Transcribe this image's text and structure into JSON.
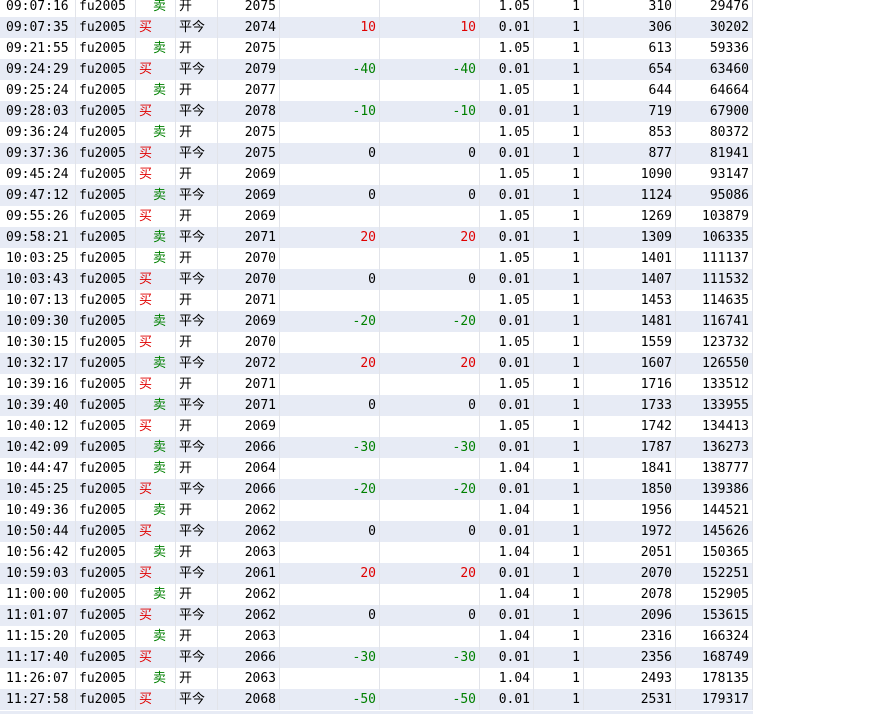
{
  "table": {
    "rows": [
      {
        "time": "09:07:16",
        "code": "fu2005",
        "dir": "卖",
        "side": "sell",
        "oc": "开",
        "price": "2075",
        "pl1": "",
        "pl2": "",
        "fee": "1.05",
        "qty": "1",
        "v1": "310",
        "v2": "29476"
      },
      {
        "time": "09:07:35",
        "code": "fu2005",
        "dir": "买",
        "side": "buy",
        "oc": "平今",
        "price": "2074",
        "pl1": "10",
        "pl2": "10",
        "fee": "0.01",
        "qty": "1",
        "v1": "306",
        "v2": "30202"
      },
      {
        "time": "09:21:55",
        "code": "fu2005",
        "dir": "卖",
        "side": "sell",
        "oc": "开",
        "price": "2075",
        "pl1": "",
        "pl2": "",
        "fee": "1.05",
        "qty": "1",
        "v1": "613",
        "v2": "59336"
      },
      {
        "time": "09:24:29",
        "code": "fu2005",
        "dir": "买",
        "side": "buy",
        "oc": "平今",
        "price": "2079",
        "pl1": "-40",
        "pl2": "-40",
        "fee": "0.01",
        "qty": "1",
        "v1": "654",
        "v2": "63460"
      },
      {
        "time": "09:25:24",
        "code": "fu2005",
        "dir": "卖",
        "side": "sell",
        "oc": "开",
        "price": "2077",
        "pl1": "",
        "pl2": "",
        "fee": "1.05",
        "qty": "1",
        "v1": "644",
        "v2": "64664"
      },
      {
        "time": "09:28:03",
        "code": "fu2005",
        "dir": "买",
        "side": "buy",
        "oc": "平今",
        "price": "2078",
        "pl1": "-10",
        "pl2": "-10",
        "fee": "0.01",
        "qty": "1",
        "v1": "719",
        "v2": "67900"
      },
      {
        "time": "09:36:24",
        "code": "fu2005",
        "dir": "卖",
        "side": "sell",
        "oc": "开",
        "price": "2075",
        "pl1": "",
        "pl2": "",
        "fee": "1.05",
        "qty": "1",
        "v1": "853",
        "v2": "80372"
      },
      {
        "time": "09:37:36",
        "code": "fu2005",
        "dir": "买",
        "side": "buy",
        "oc": "平今",
        "price": "2075",
        "pl1": "0",
        "pl2": "0",
        "fee": "0.01",
        "qty": "1",
        "v1": "877",
        "v2": "81941"
      },
      {
        "time": "09:45:24",
        "code": "fu2005",
        "dir": "买",
        "side": "buy",
        "oc": "开",
        "price": "2069",
        "pl1": "",
        "pl2": "",
        "fee": "1.05",
        "qty": "1",
        "v1": "1090",
        "v2": "93147"
      },
      {
        "time": "09:47:12",
        "code": "fu2005",
        "dir": "卖",
        "side": "sell",
        "oc": "平今",
        "price": "2069",
        "pl1": "0",
        "pl2": "0",
        "fee": "0.01",
        "qty": "1",
        "v1": "1124",
        "v2": "95086"
      },
      {
        "time": "09:55:26",
        "code": "fu2005",
        "dir": "买",
        "side": "buy",
        "oc": "开",
        "price": "2069",
        "pl1": "",
        "pl2": "",
        "fee": "1.05",
        "qty": "1",
        "v1": "1269",
        "v2": "103879"
      },
      {
        "time": "09:58:21",
        "code": "fu2005",
        "dir": "卖",
        "side": "sell",
        "oc": "平今",
        "price": "2071",
        "pl1": "20",
        "pl2": "20",
        "fee": "0.01",
        "qty": "1",
        "v1": "1309",
        "v2": "106335"
      },
      {
        "time": "10:03:25",
        "code": "fu2005",
        "dir": "卖",
        "side": "sell",
        "oc": "开",
        "price": "2070",
        "pl1": "",
        "pl2": "",
        "fee": "1.05",
        "qty": "1",
        "v1": "1401",
        "v2": "111137"
      },
      {
        "time": "10:03:43",
        "code": "fu2005",
        "dir": "买",
        "side": "buy",
        "oc": "平今",
        "price": "2070",
        "pl1": "0",
        "pl2": "0",
        "fee": "0.01",
        "qty": "1",
        "v1": "1407",
        "v2": "111532"
      },
      {
        "time": "10:07:13",
        "code": "fu2005",
        "dir": "买",
        "side": "buy",
        "oc": "开",
        "price": "2071",
        "pl1": "",
        "pl2": "",
        "fee": "1.05",
        "qty": "1",
        "v1": "1453",
        "v2": "114635"
      },
      {
        "time": "10:09:30",
        "code": "fu2005",
        "dir": "卖",
        "side": "sell",
        "oc": "平今",
        "price": "2069",
        "pl1": "-20",
        "pl2": "-20",
        "fee": "0.01",
        "qty": "1",
        "v1": "1481",
        "v2": "116741"
      },
      {
        "time": "10:30:15",
        "code": "fu2005",
        "dir": "买",
        "side": "buy",
        "oc": "开",
        "price": "2070",
        "pl1": "",
        "pl2": "",
        "fee": "1.05",
        "qty": "1",
        "v1": "1559",
        "v2": "123732"
      },
      {
        "time": "10:32:17",
        "code": "fu2005",
        "dir": "卖",
        "side": "sell",
        "oc": "平今",
        "price": "2072",
        "pl1": "20",
        "pl2": "20",
        "fee": "0.01",
        "qty": "1",
        "v1": "1607",
        "v2": "126550"
      },
      {
        "time": "10:39:16",
        "code": "fu2005",
        "dir": "买",
        "side": "buy",
        "oc": "开",
        "price": "2071",
        "pl1": "",
        "pl2": "",
        "fee": "1.05",
        "qty": "1",
        "v1": "1716",
        "v2": "133512"
      },
      {
        "time": "10:39:40",
        "code": "fu2005",
        "dir": "卖",
        "side": "sell",
        "oc": "平今",
        "price": "2071",
        "pl1": "0",
        "pl2": "0",
        "fee": "0.01",
        "qty": "1",
        "v1": "1733",
        "v2": "133955"
      },
      {
        "time": "10:40:12",
        "code": "fu2005",
        "dir": "买",
        "side": "buy",
        "oc": "开",
        "price": "2069",
        "pl1": "",
        "pl2": "",
        "fee": "1.05",
        "qty": "1",
        "v1": "1742",
        "v2": "134413"
      },
      {
        "time": "10:42:09",
        "code": "fu2005",
        "dir": "卖",
        "side": "sell",
        "oc": "平今",
        "price": "2066",
        "pl1": "-30",
        "pl2": "-30",
        "fee": "0.01",
        "qty": "1",
        "v1": "1787",
        "v2": "136273"
      },
      {
        "time": "10:44:47",
        "code": "fu2005",
        "dir": "卖",
        "side": "sell",
        "oc": "开",
        "price": "2064",
        "pl1": "",
        "pl2": "",
        "fee": "1.04",
        "qty": "1",
        "v1": "1841",
        "v2": "138777"
      },
      {
        "time": "10:45:25",
        "code": "fu2005",
        "dir": "买",
        "side": "buy",
        "oc": "平今",
        "price": "2066",
        "pl1": "-20",
        "pl2": "-20",
        "fee": "0.01",
        "qty": "1",
        "v1": "1850",
        "v2": "139386"
      },
      {
        "time": "10:49:36",
        "code": "fu2005",
        "dir": "卖",
        "side": "sell",
        "oc": "开",
        "price": "2062",
        "pl1": "",
        "pl2": "",
        "fee": "1.04",
        "qty": "1",
        "v1": "1956",
        "v2": "144521"
      },
      {
        "time": "10:50:44",
        "code": "fu2005",
        "dir": "买",
        "side": "buy",
        "oc": "平今",
        "price": "2062",
        "pl1": "0",
        "pl2": "0",
        "fee": "0.01",
        "qty": "1",
        "v1": "1972",
        "v2": "145626"
      },
      {
        "time": "10:56:42",
        "code": "fu2005",
        "dir": "卖",
        "side": "sell",
        "oc": "开",
        "price": "2063",
        "pl1": "",
        "pl2": "",
        "fee": "1.04",
        "qty": "1",
        "v1": "2051",
        "v2": "150365"
      },
      {
        "time": "10:59:03",
        "code": "fu2005",
        "dir": "买",
        "side": "buy",
        "oc": "平今",
        "price": "2061",
        "pl1": "20",
        "pl2": "20",
        "fee": "0.01",
        "qty": "1",
        "v1": "2070",
        "v2": "152251"
      },
      {
        "time": "11:00:00",
        "code": "fu2005",
        "dir": "卖",
        "side": "sell",
        "oc": "开",
        "price": "2062",
        "pl1": "",
        "pl2": "",
        "fee": "1.04",
        "qty": "1",
        "v1": "2078",
        "v2": "152905"
      },
      {
        "time": "11:01:07",
        "code": "fu2005",
        "dir": "买",
        "side": "buy",
        "oc": "平今",
        "price": "2062",
        "pl1": "0",
        "pl2": "0",
        "fee": "0.01",
        "qty": "1",
        "v1": "2096",
        "v2": "153615"
      },
      {
        "time": "11:15:20",
        "code": "fu2005",
        "dir": "卖",
        "side": "sell",
        "oc": "开",
        "price": "2063",
        "pl1": "",
        "pl2": "",
        "fee": "1.04",
        "qty": "1",
        "v1": "2316",
        "v2": "166324"
      },
      {
        "time": "11:17:40",
        "code": "fu2005",
        "dir": "买",
        "side": "buy",
        "oc": "平今",
        "price": "2066",
        "pl1": "-30",
        "pl2": "-30",
        "fee": "0.01",
        "qty": "1",
        "v1": "2356",
        "v2": "168749"
      },
      {
        "time": "11:26:07",
        "code": "fu2005",
        "dir": "卖",
        "side": "sell",
        "oc": "开",
        "price": "2063",
        "pl1": "",
        "pl2": "",
        "fee": "1.04",
        "qty": "1",
        "v1": "2493",
        "v2": "178135"
      },
      {
        "time": "11:27:58",
        "code": "fu2005",
        "dir": "买",
        "side": "buy",
        "oc": "平今",
        "price": "2068",
        "pl1": "-50",
        "pl2": "-50",
        "fee": "0.01",
        "qty": "1",
        "v1": "2531",
        "v2": "179317"
      }
    ]
  },
  "colors": {
    "buy": "#e00000",
    "sell": "#008000",
    "alt_row": "#e7ebf5"
  }
}
